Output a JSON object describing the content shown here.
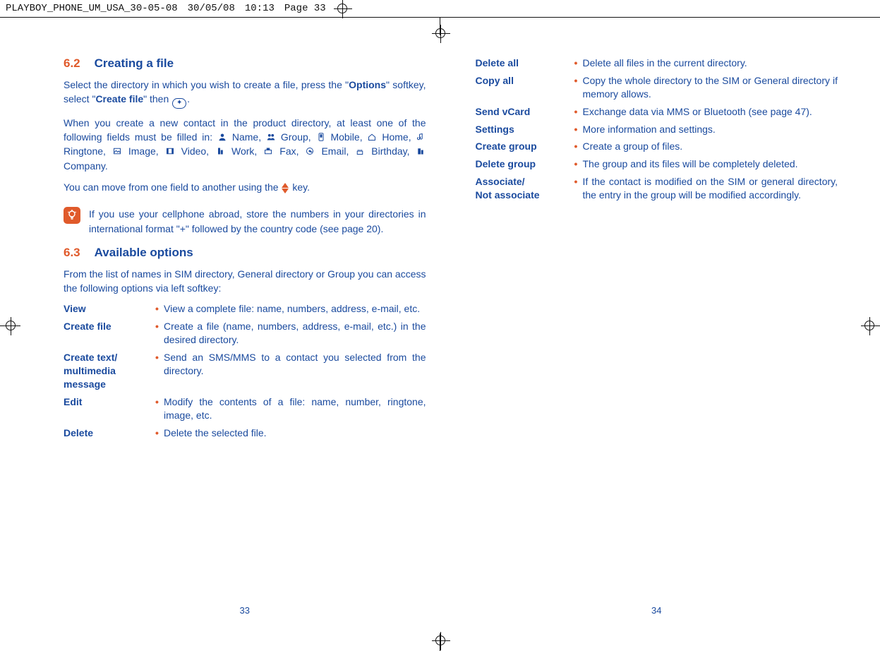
{
  "header": {
    "filename": "PLAYBOY_PHONE_UM_USA_30-05-08",
    "date": "30/05/08",
    "time": "10:13",
    "page_label": "Page 33"
  },
  "left_page": {
    "number": "33",
    "section62": {
      "num": "6.2",
      "title": "Creating a file",
      "p1_a": "Select the directory in which you wish to create a file, press the \"",
      "p1_b": "Options",
      "p1_c": "\" softkey,  select \"",
      "p1_d": "Create file",
      "p1_e": "\" then ",
      "p1_f": ".",
      "p2_a": "When you create a new contact in the product directory, at least one of the following fields must be filled in: ",
      "p2_list": "Name,  Group,  Mobile,  Home,  Ringtone,  Image,  Video,  Work,  Fax,  Email,  Birthday,  Company.",
      "fields": {
        "name": " Name, ",
        "group": " Group, ",
        "mobile": " Mobile, ",
        "home": " Home, ",
        "ringtone": " Ringtone, ",
        "image": " Image, ",
        "video": " Video, ",
        "work": " Work, ",
        "fax": " Fax, ",
        "email": " Email, ",
        "birthday": " Birthday, ",
        "company": " Company."
      },
      "p3_a": "You can move from one field to another using the ",
      "p3_b": " key.",
      "tip": "If you use your cellphone abroad, store the numbers in your directories in international format \"+\" followed by the country code (see page 20)."
    },
    "section63": {
      "num": "6.3",
      "title": "Available options",
      "intro": "From the list of names in SIM directory, General directory or Group you can access the following options via left softkey:",
      "options": [
        {
          "label": "View",
          "desc": "View a complete file: name,  numbers,  address,  e-mail,  etc."
        },
        {
          "label": "Create file",
          "desc": "Create a file (name,  numbers,  address,  e-mail,  etc.) in the desired directory."
        },
        {
          "label": "Create text/\nmultimedia\nmessage",
          "desc": "Send an SMS/MMS to a contact you selected from the directory."
        },
        {
          "label": "Edit",
          "desc": "Modify the contents of a file: name, number, ringtone,  image,  etc."
        },
        {
          "label": "Delete",
          "desc": "Delete the selected file."
        }
      ]
    }
  },
  "right_page": {
    "number": "34",
    "options": [
      {
        "label": "Delete all",
        "desc": "Delete all files in the current directory."
      },
      {
        "label": "Copy all",
        "desc": "Copy the whole directory to the SIM or General directory if memory allows."
      },
      {
        "label": "Send vCard",
        "desc": "Exchange data via MMS or Bluetooth (see page 47)."
      },
      {
        "label": "Settings",
        "desc": "More information and settings."
      },
      {
        "label": "Create group",
        "desc": "Create a group of files."
      },
      {
        "label": "Delete group",
        "desc": "The group and its files will be completely deleted."
      },
      {
        "label": "Associate/\nNot associate",
        "desc": "If the contact is modified on the SIM or general directory,  the entry in the group will be modified accordingly."
      }
    ]
  }
}
